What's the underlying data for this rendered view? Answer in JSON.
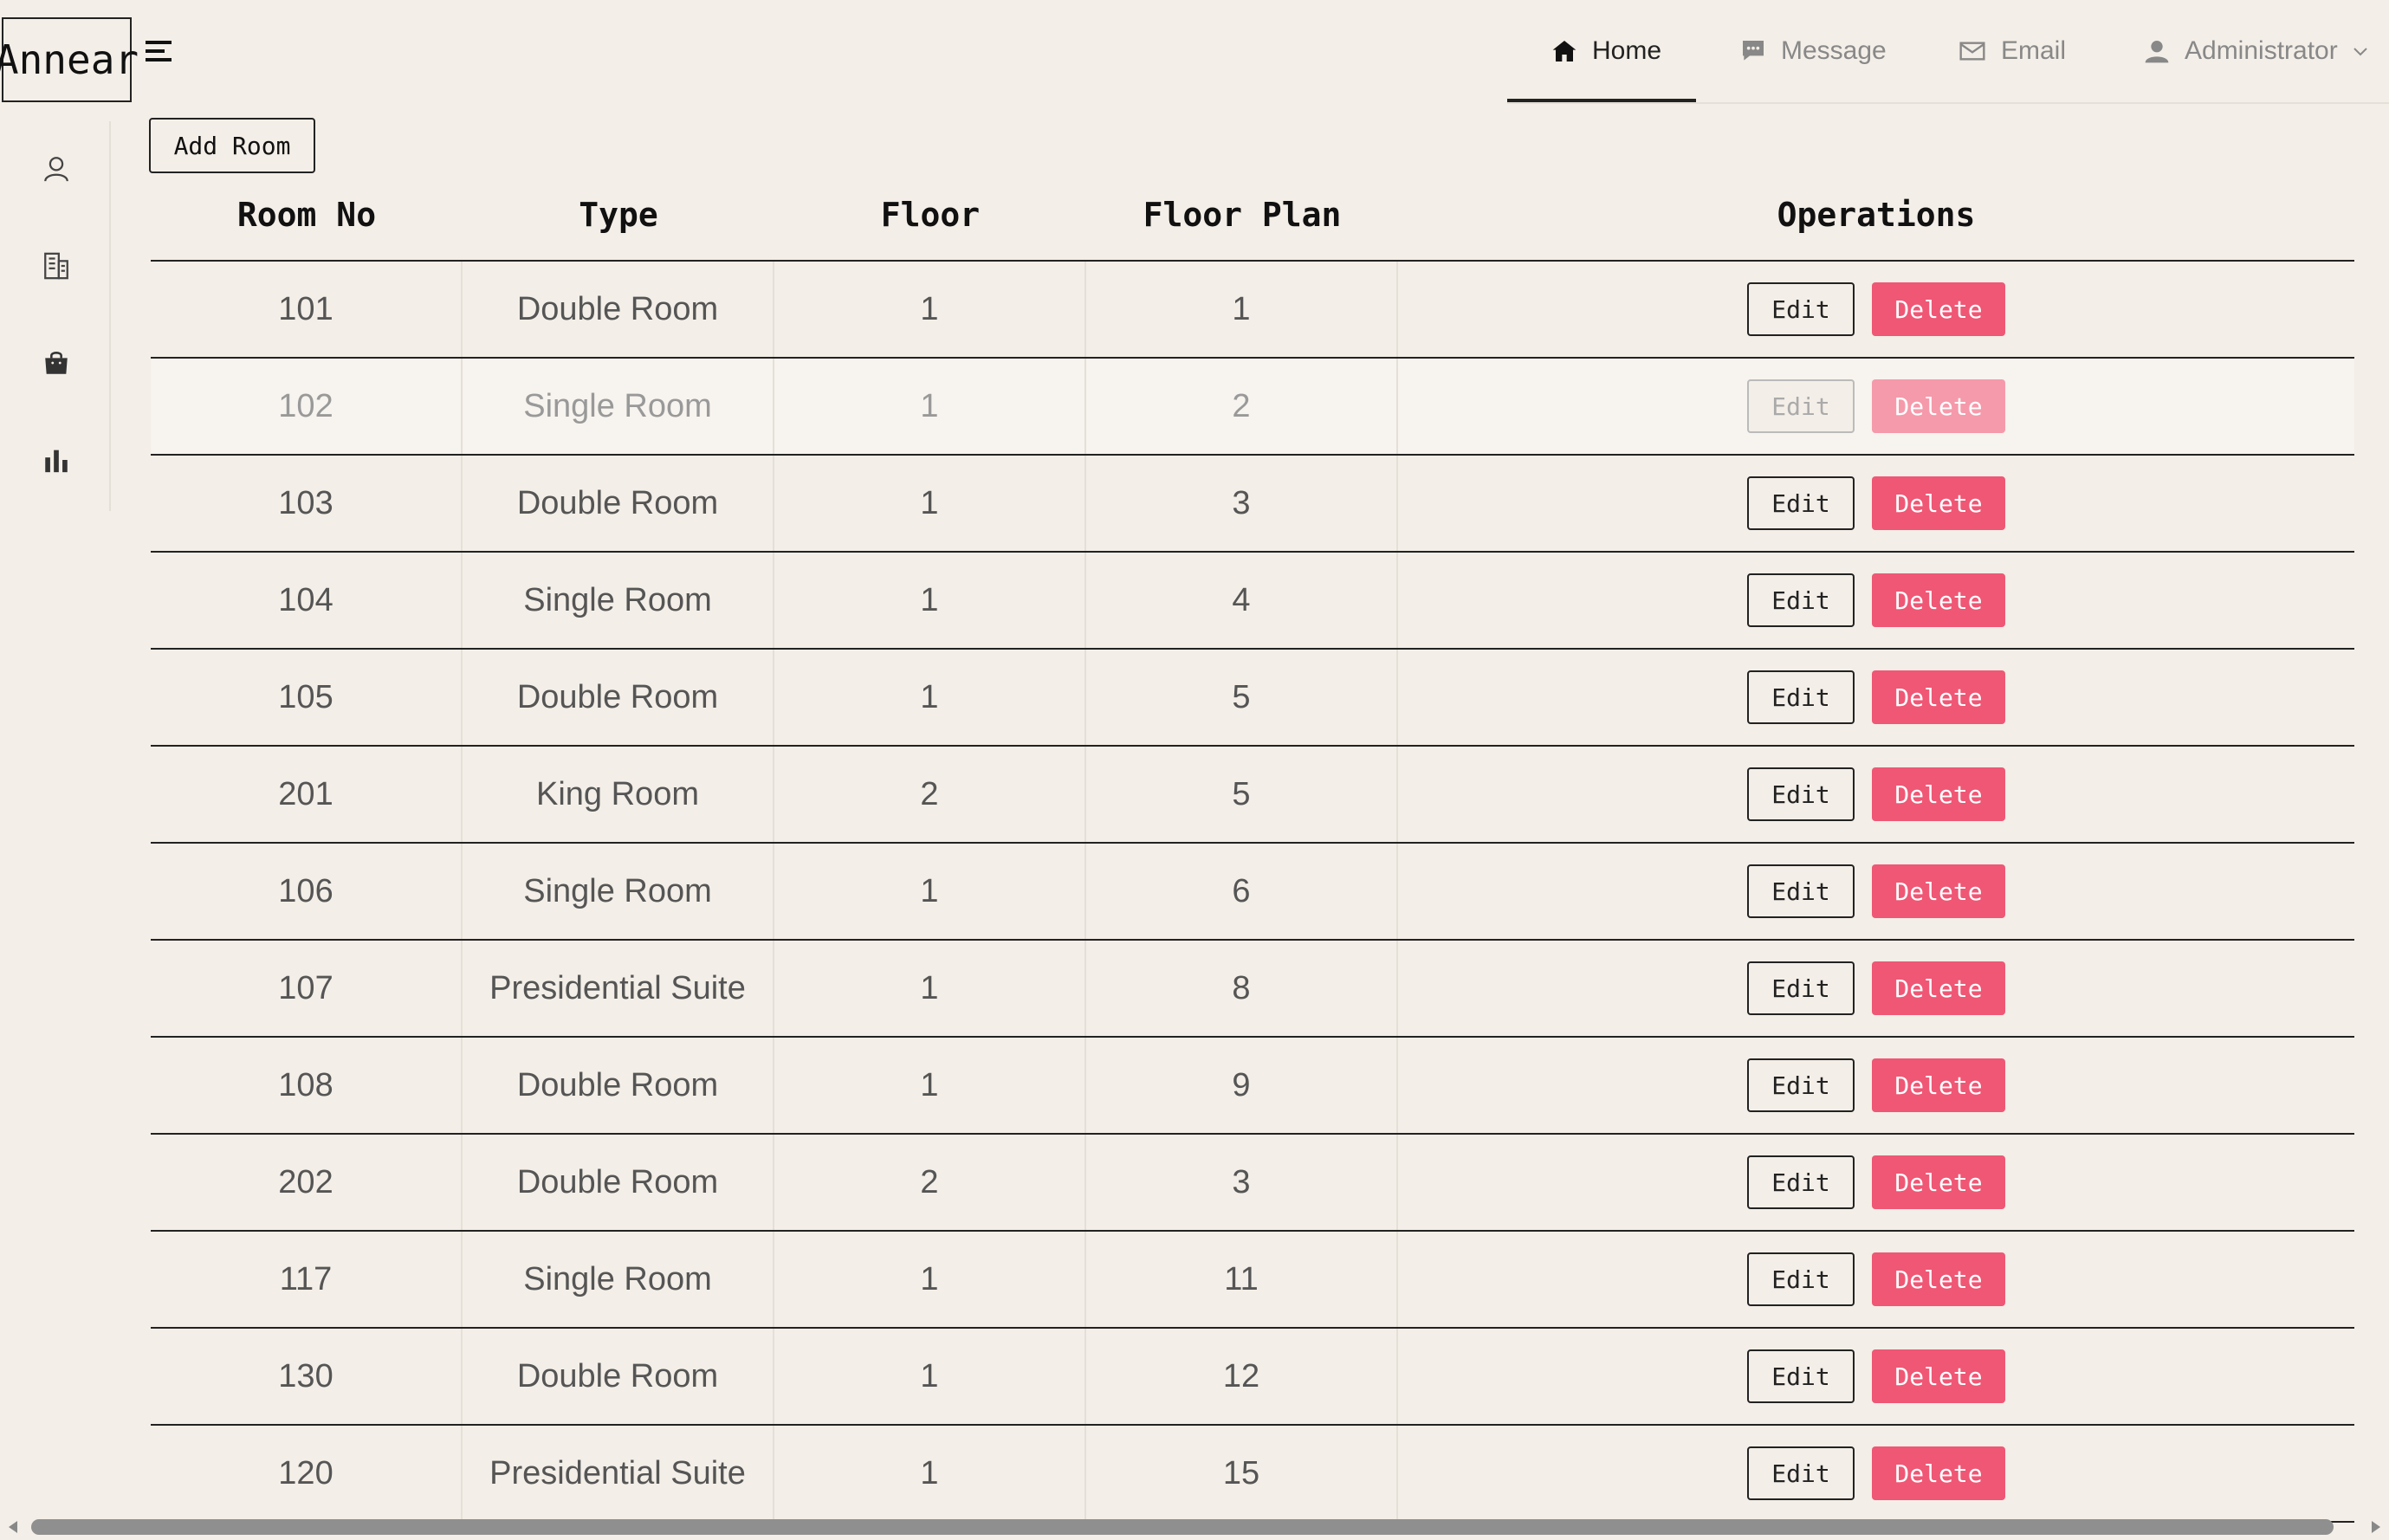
{
  "app": {
    "logo": "Annear"
  },
  "topnav": {
    "items": [
      {
        "label": "Home",
        "icon": "home-icon",
        "active": true
      },
      {
        "label": "Message",
        "icon": "message-icon",
        "active": false
      },
      {
        "label": "Email",
        "icon": "email-icon",
        "active": false
      },
      {
        "label": "Administrator",
        "icon": "user-icon",
        "active": false
      }
    ]
  },
  "sidebar": {
    "icons": [
      "user-icon",
      "building-icon",
      "bag-icon",
      "bar-chart-icon"
    ]
  },
  "toolbar": {
    "add_label": "Add Room"
  },
  "table": {
    "columns": [
      "Room No",
      "Type",
      "Floor",
      "Floor Plan",
      "Operations"
    ],
    "edit_label": "Edit",
    "delete_label": "Delete",
    "rows": [
      {
        "room_no": "101",
        "type": "Double Room",
        "floor": "1",
        "floor_plan": "1"
      },
      {
        "room_no": "102",
        "type": "Single Room",
        "floor": "1",
        "floor_plan": "2"
      },
      {
        "room_no": "103",
        "type": "Double Room",
        "floor": "1",
        "floor_plan": "3"
      },
      {
        "room_no": "104",
        "type": "Single Room",
        "floor": "1",
        "floor_plan": "4"
      },
      {
        "room_no": "105",
        "type": "Double Room",
        "floor": "1",
        "floor_plan": "5"
      },
      {
        "room_no": "201",
        "type": "King Room",
        "floor": "2",
        "floor_plan": "5"
      },
      {
        "room_no": "106",
        "type": "Single Room",
        "floor": "1",
        "floor_plan": "6"
      },
      {
        "room_no": "107",
        "type": "Presidential Suite",
        "floor": "1",
        "floor_plan": "8"
      },
      {
        "room_no": "108",
        "type": "Double Room",
        "floor": "1",
        "floor_plan": "9"
      },
      {
        "room_no": "202",
        "type": "Double Room",
        "floor": "2",
        "floor_plan": "3"
      },
      {
        "room_no": "117",
        "type": "Single Room",
        "floor": "1",
        "floor_plan": "11"
      },
      {
        "room_no": "130",
        "type": "Double Room",
        "floor": "1",
        "floor_plan": "12"
      },
      {
        "room_no": "120",
        "type": "Presidential Suite",
        "floor": "1",
        "floor_plan": "15"
      }
    ]
  },
  "colors": {
    "background": "#f3eee7",
    "delete": "#ef5775",
    "border": "#222222"
  }
}
